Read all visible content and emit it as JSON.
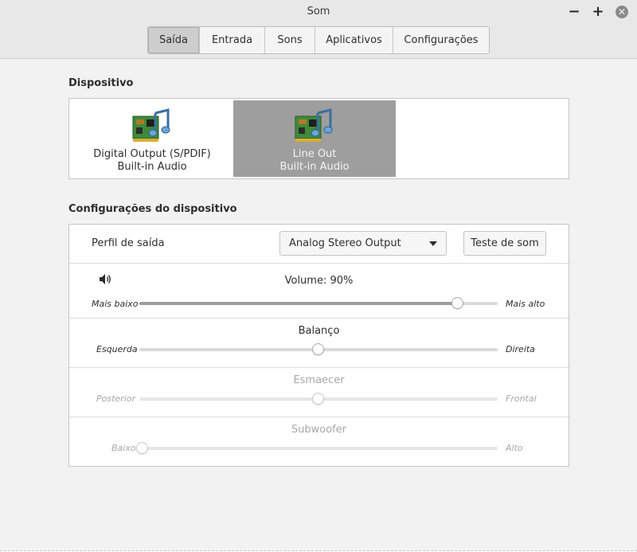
{
  "window": {
    "title": "Som"
  },
  "controls": {
    "minimize": "−",
    "maximize": "+",
    "close": "✕"
  },
  "tabs": [
    {
      "label": "Saída",
      "active": true
    },
    {
      "label": "Entrada",
      "active": false
    },
    {
      "label": "Sons",
      "active": false
    },
    {
      "label": "Aplicativos",
      "active": false
    },
    {
      "label": "Configurações",
      "active": false
    }
  ],
  "device_section": {
    "title": "Dispositivo",
    "devices": [
      {
        "name": "Digital Output (S/PDIF)",
        "subtitle": "Built-in Audio",
        "icon": "sound-card-icon",
        "selected": false
      },
      {
        "name": "Line Out",
        "subtitle": "Built-in Audio",
        "icon": "sound-card-icon",
        "selected": true
      }
    ]
  },
  "settings_section": {
    "title": "Configurações do dispositivo",
    "profile_label": "Perfil de saída",
    "profile_value": "Analog Stereo Output",
    "test_button": "Teste de som",
    "volume": {
      "title": "Volume: 90%",
      "left": "Mais baixo",
      "right": "Mais alto",
      "value": 0.9,
      "icon": "speaker-icon"
    },
    "balance": {
      "title": "Balanço",
      "left": "Esquerda",
      "right": "Direita",
      "value": 0.5
    },
    "fade": {
      "title": "Esmaecer",
      "left": "Posterior",
      "right": "Frontal",
      "value": 0.5,
      "enabled": false
    },
    "subwoofer": {
      "title": "Subwoofer",
      "left": "Baixo",
      "right": "Alto",
      "value": 0.0,
      "enabled": false
    }
  }
}
